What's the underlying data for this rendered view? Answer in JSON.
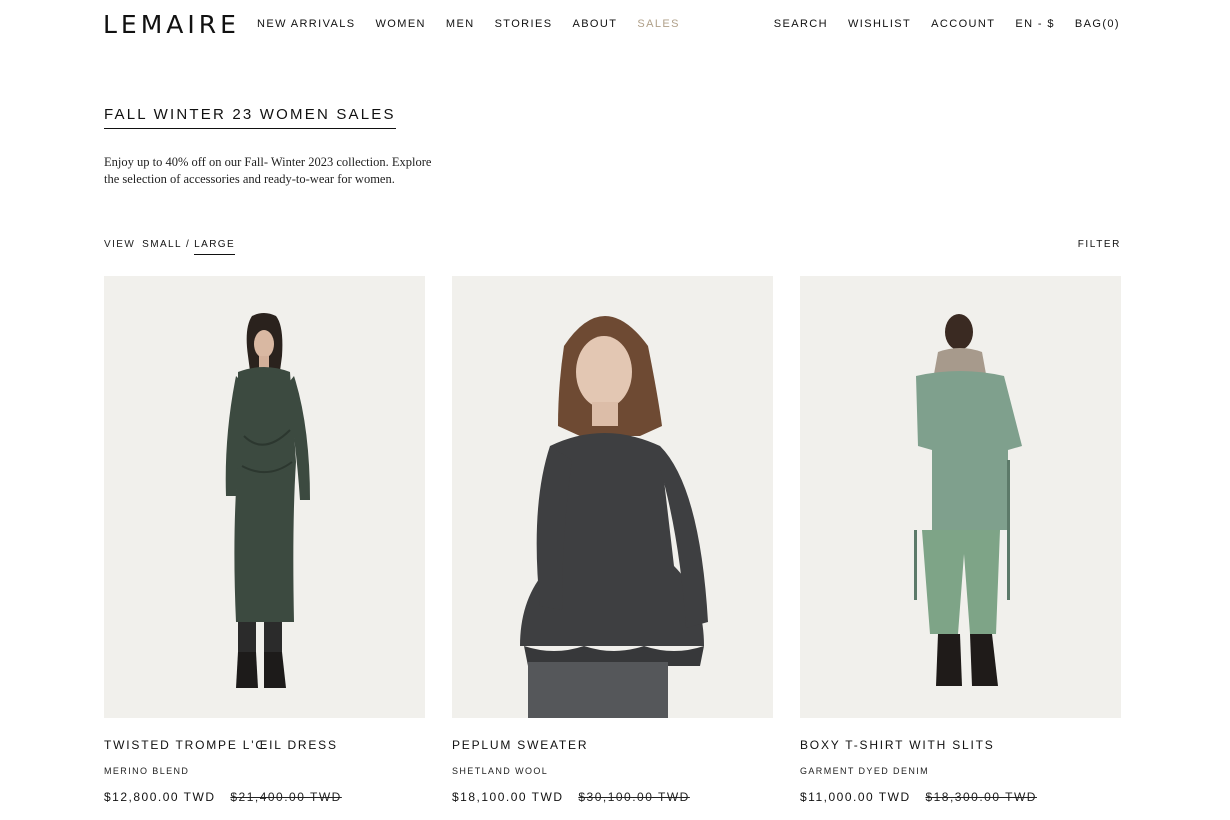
{
  "header": {
    "logo": "LEMAIRE",
    "nav_left": [
      "NEW ARRIVALS",
      "WOMEN",
      "MEN",
      "STORIES",
      "ABOUT",
      "SALES"
    ],
    "nav_right": [
      "SEARCH",
      "WISHLIST",
      "ACCOUNT",
      "EN - $",
      "BAG(0)"
    ]
  },
  "page": {
    "title": "FALL WINTER 23 WOMEN SALES",
    "intro": "Enjoy up to 40% off on our Fall- Winter 2023 collection. Explore the selection of accessories and ready-to-wear for women."
  },
  "view": {
    "label": "VIEW",
    "small": "SMALL",
    "separator": "/",
    "large": "LARGE",
    "active": "LARGE"
  },
  "filter_label": "FILTER",
  "products": [
    {
      "name": "TWISTED TROMPE L'ŒIL DRESS",
      "material": "MERINO BLEND",
      "price": "$12,800.00 TWD",
      "original_price": "$21,400.00 TWD",
      "garment_color": "#3c4a40"
    },
    {
      "name": "PEPLUM SWEATER",
      "material": "SHETLAND WOOL",
      "price": "$18,100.00 TWD",
      "original_price": "$30,100.00 TWD",
      "garment_color": "#3e3f41"
    },
    {
      "name": "BOXY T-SHIRT WITH SLITS",
      "material": "GARMENT DYED DENIM",
      "price": "$11,000.00 TWD",
      "original_price": "$18,300.00 TWD",
      "garment_color": "#7fa08d"
    }
  ]
}
